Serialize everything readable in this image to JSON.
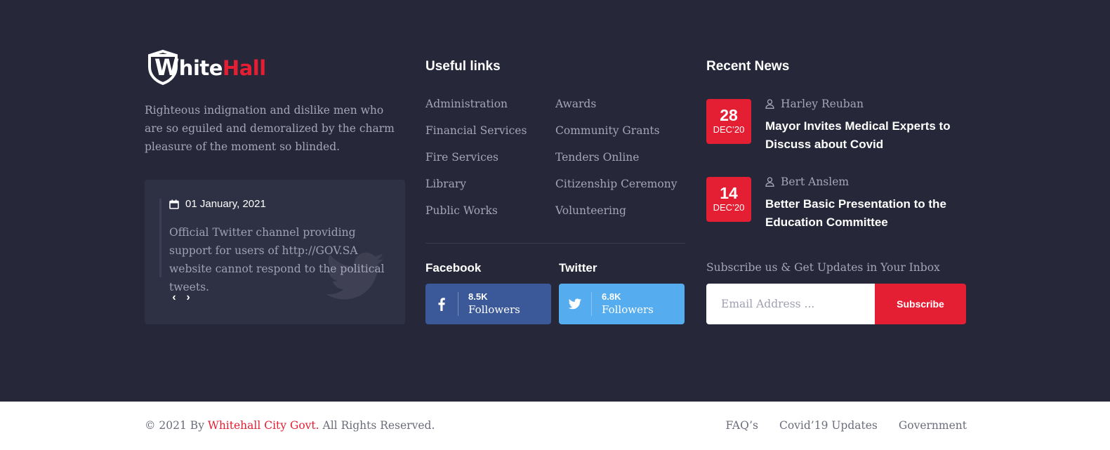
{
  "brand": {
    "logo_first": "hite",
    "logo_letter": "W",
    "logo_second": "Hall",
    "description": "Righteous indignation and dislike men who are so eguiled and demoralized by the charm pleasure of the moment so blinded."
  },
  "twitter_feed": {
    "date": "01 January, 2021",
    "text": "Official Twitter channel providing support for users of http://GOV.SA website cannot respond to the political tweets.",
    "prev": "‹",
    "next": "›",
    "icons": [
      "calendar-icon",
      "twitter-bird-icon"
    ]
  },
  "useful_links": {
    "title": "Useful links",
    "col1": [
      "Administration",
      "Financial Services",
      "Fire Services",
      "Library",
      "Public Works"
    ],
    "col2": [
      "Awards",
      "Community Grants",
      "Tenders Online",
      "Citizenship Ceremony",
      "Volunteering"
    ]
  },
  "social": {
    "facebook": {
      "title": "Facebook",
      "count": "8.5K",
      "label": "Followers",
      "color": "#3b5998",
      "icon": "facebook-icon"
    },
    "twitter": {
      "title": "Twitter",
      "count": "6.8K",
      "label": "Followers",
      "color": "#55acee",
      "icon": "twitter-icon"
    }
  },
  "recent_news": {
    "title": "Recent News",
    "items": [
      {
        "day": "28",
        "month": "DEC’20",
        "author": "Harley Reuban",
        "title": "Mayor Invites Medical Experts to Discuss about Covid"
      },
      {
        "day": "14",
        "month": "DEC’20",
        "author": "Bert Anslem",
        "title": "Better Basic Presentation to the Education Committee"
      }
    ]
  },
  "subscribe": {
    "label": "Subscribe us & Get Updates in Your Inbox",
    "placeholder": "Email Address ...",
    "button": "Subscribe"
  },
  "footer": {
    "copyright_prefix": "© 2021 By",
    "copyright_brand": "Whitehall City Govt.",
    "copyright_suffix": "All Rights Reserved.",
    "links": [
      "FAQ’s",
      "Covid’19 Updates",
      "Government"
    ]
  },
  "colors": {
    "background": "#262839",
    "accent": "#e41e33",
    "card": "#2e3044",
    "muted_text": "#a4a6b6"
  }
}
